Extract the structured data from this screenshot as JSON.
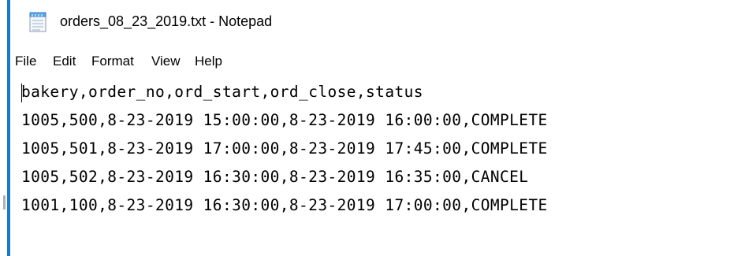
{
  "window": {
    "title": "orders_08_23_2019.txt - Notepad",
    "icon": "notepad-icon"
  },
  "menu": [
    "File",
    "Edit",
    "Format",
    "View",
    "Help"
  ],
  "editor": {
    "lines": [
      "bakery,order_no,ord_start,ord_close,status",
      "1005,500,8-23-2019 15:00:00,8-23-2019 16:00:00,COMPLETE",
      "1005,501,8-23-2019 17:00:00,8-23-2019 17:45:00,COMPLETE",
      "1005,502,8-23-2019 16:30:00,8-23-2019 16:35:00,CANCEL",
      "1001,100,8-23-2019 16:30:00,8-23-2019 17:00:00,COMPLETE"
    ]
  },
  "colors": {
    "window_border": "#1979ca",
    "background": "#ffffff",
    "text": "#000000"
  }
}
